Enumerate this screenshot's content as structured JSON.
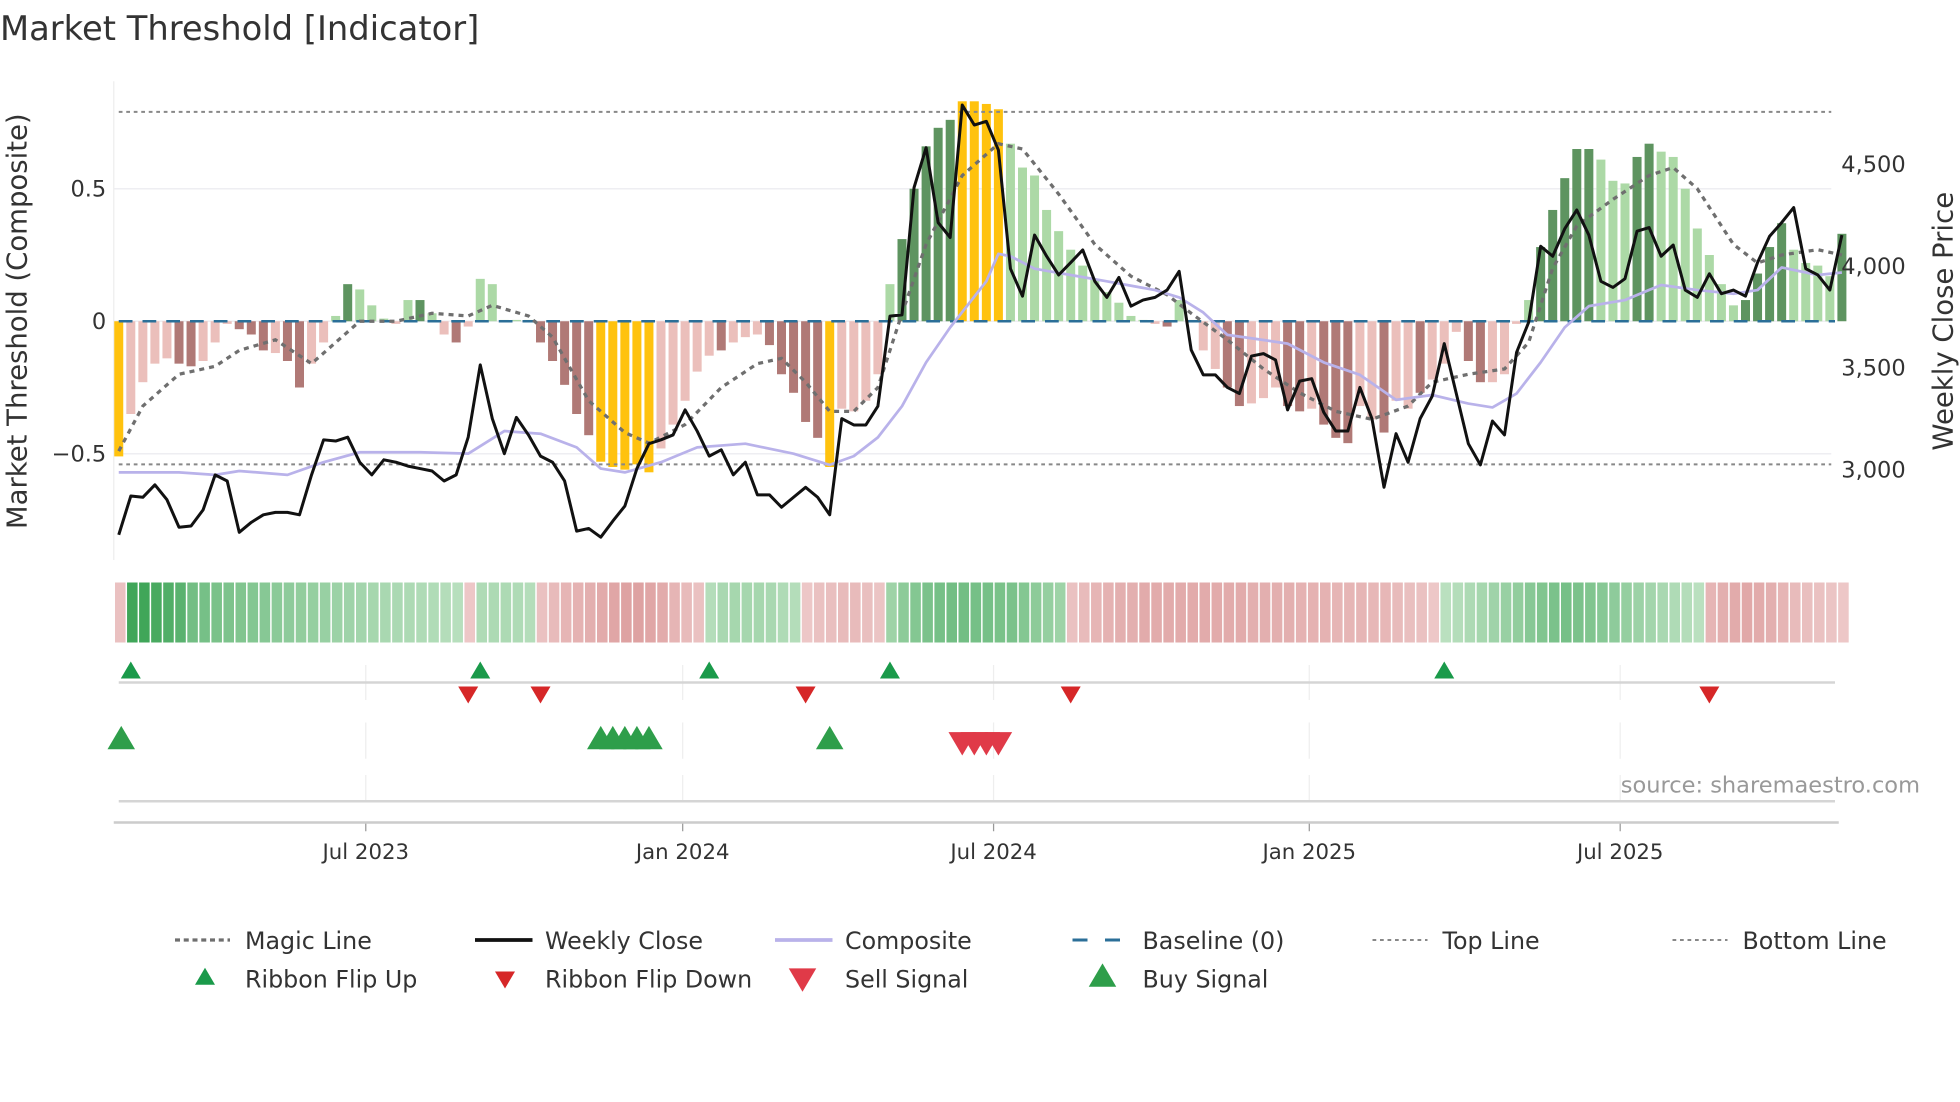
{
  "title": "Market Threshold [Indicator]",
  "source": "source: sharemaestro.com",
  "colors": {
    "yellow": "#ffc20e",
    "dark_green": "#5e9460",
    "light_green": "#acd9a6",
    "dark_red": "#b07976",
    "light_red": "#ebbfbb",
    "black": "#111111",
    "composite": "#b9b2ea",
    "magic": "#6f6f6f",
    "baseline": "#2b6f98",
    "flip_up": "#1a9a4a",
    "flip_down": "#d62728",
    "sell": "#e03a48",
    "buy": "#2e9e4a"
  },
  "chart_data": {
    "type": "bar+line",
    "title": "Market Threshold [Indicator]",
    "xlabel": "",
    "ylabel": "Market Threshold (Composite)",
    "ylabel_right": "Weekly Close Price",
    "ylim": [
      -0.9,
      0.9
    ],
    "ylim_right": [
      2550,
      4900
    ],
    "yticks": [
      {
        "v": 0.5,
        "label": "0.5"
      },
      {
        "v": 0,
        "label": "0"
      },
      {
        "v": -0.5,
        "label": "−0.5"
      }
    ],
    "yticks_right": [
      {
        "v": 4500,
        "label": "4,500"
      },
      {
        "v": 4000,
        "label": "4,000"
      },
      {
        "v": 3500,
        "label": "3,500"
      },
      {
        "v": 3000,
        "label": "3,000"
      }
    ],
    "xticks": [
      {
        "week": 20.5,
        "label": "Jul 2023"
      },
      {
        "week": 46.8,
        "label": "Jan 2024"
      },
      {
        "week": 72.6,
        "label": "Jul 2024"
      },
      {
        "week": 98.8,
        "label": "Jan 2025"
      },
      {
        "week": 124.6,
        "label": "Jul 2025"
      }
    ],
    "top_line": 0.79,
    "bottom_line": -0.54,
    "baseline": 0,
    "composite_bars": [
      -0.51,
      -0.35,
      -0.23,
      -0.16,
      -0.14,
      -0.16,
      -0.17,
      -0.15,
      -0.08,
      -0.01,
      -0.03,
      -0.05,
      -0.11,
      -0.12,
      -0.15,
      -0.25,
      -0.16,
      -0.08,
      0.02,
      0.14,
      0.12,
      0.06,
      0.01,
      -0.01,
      0.08,
      0.08,
      0.03,
      -0.05,
      -0.08,
      -0.02,
      0.16,
      0.14,
      0.005,
      0.005,
      0.005,
      -0.08,
      -0.15,
      -0.24,
      -0.35,
      -0.43,
      -0.53,
      -0.55,
      -0.56,
      -0.54,
      -0.57,
      -0.48,
      -0.39,
      -0.3,
      -0.19,
      -0.13,
      -0.11,
      -0.08,
      -0.06,
      -0.05,
      -0.09,
      -0.2,
      -0.27,
      -0.38,
      -0.44,
      -0.55,
      -0.33,
      -0.34,
      -0.3,
      -0.2,
      0.14,
      0.31,
      0.5,
      0.66,
      0.73,
      0.76,
      0.83,
      0.83,
      0.82,
      0.8,
      0.67,
      0.58,
      0.55,
      0.42,
      0.34,
      0.27,
      0.21,
      0.16,
      0.11,
      0.07,
      0.02,
      0.005,
      -0.01,
      -0.02,
      0.08,
      0.005,
      -0.11,
      -0.18,
      -0.25,
      -0.32,
      -0.31,
      -0.29,
      -0.25,
      -0.32,
      -0.34,
      -0.33,
      -0.39,
      -0.44,
      -0.46,
      -0.32,
      -0.37,
      -0.42,
      -0.3,
      -0.33,
      -0.27,
      -0.22,
      -0.16,
      -0.04,
      -0.15,
      -0.23,
      -0.23,
      -0.2,
      -0.01,
      0.08,
      0.28,
      0.42,
      0.54,
      0.65,
      0.65,
      0.61,
      0.53,
      0.52,
      0.62,
      0.67,
      0.64,
      0.62,
      0.5,
      0.35,
      0.25,
      0.14,
      0.06,
      0.08,
      0.18,
      0.28,
      0.37,
      0.27,
      0.22,
      0.21,
      0.17,
      0.33
    ],
    "bar_classes": "YrrrrRRrrrRRRrRRrrgGgggrgGgrRrgggggRRRRRYYYYYrrrrrRrrrRRRRRYrrrrgGGGGGYYYYggggggggggggrRggrrRRrrrRRrRRRrrRrrRrrrRRrrrgGGGGGgggGGgggggggGGGGggggG",
    "weekly_close": [
      2676,
      2866,
      2860,
      2921,
      2848,
      2713,
      2719,
      2798,
      2970,
      2940,
      2688,
      2737,
      2774,
      2786,
      2786,
      2774,
      2970,
      3142,
      3136,
      3155,
      3032,
      2970,
      3044,
      3032,
      3013,
      3001,
      2989,
      2940,
      2970,
      3155,
      3510,
      3246,
      3074,
      3252,
      3166,
      3062,
      3032,
      2940,
      2694,
      2707,
      2664,
      2743,
      2817,
      3001,
      3123,
      3142,
      3166,
      3289,
      3185,
      3062,
      3093,
      2970,
      3032,
      2872,
      2872,
      2811,
      2860,
      2909,
      2860,
      2774,
      3246,
      3215,
      3215,
      3307,
      3749,
      3755,
      4380,
      4576,
      4208,
      4135,
      4785,
      4687,
      4705,
      4564,
      3982,
      3847,
      4147,
      4043,
      3951,
      4012,
      4074,
      3920,
      3841,
      3939,
      3798,
      3828,
      3841,
      3877,
      3969,
      3583,
      3461,
      3461,
      3399,
      3369,
      3553,
      3565,
      3534,
      3289,
      3430,
      3442,
      3277,
      3185,
      3185,
      3399,
      3246,
      2909,
      3172,
      3032,
      3246,
      3356,
      3614,
      3369,
      3123,
      3019,
      3234,
      3166,
      3571,
      3718,
      4092,
      4043,
      4178,
      4270,
      4147,
      3920,
      3890,
      3933,
      4166,
      4184,
      4043,
      4098,
      3877,
      3841,
      3957,
      3859,
      3877,
      3847,
      4012,
      4141,
      4208,
      4282,
      3982,
      3951,
      3877,
      4147
    ],
    "magic_line": [
      [
        0,
        -0.49
      ],
      [
        2,
        -0.32
      ],
      [
        5,
        -0.2
      ],
      [
        8,
        -0.17
      ],
      [
        10,
        -0.11
      ],
      [
        13,
        -0.07
      ],
      [
        16,
        -0.16
      ],
      [
        18,
        -0.08
      ],
      [
        20,
        0
      ],
      [
        23,
        0
      ],
      [
        26,
        0.03
      ],
      [
        29,
        0.02
      ],
      [
        31,
        0.06
      ],
      [
        34,
        0.02
      ],
      [
        36,
        -0.06
      ],
      [
        39,
        -0.3
      ],
      [
        42,
        -0.42
      ],
      [
        44,
        -0.46
      ],
      [
        47,
        -0.39
      ],
      [
        50,
        -0.25
      ],
      [
        53,
        -0.16
      ],
      [
        55,
        -0.14
      ],
      [
        57,
        -0.23
      ],
      [
        59,
        -0.34
      ],
      [
        61,
        -0.34
      ],
      [
        63,
        -0.25
      ],
      [
        65,
        0.03
      ],
      [
        67,
        0.29
      ],
      [
        70,
        0.55
      ],
      [
        73,
        0.67
      ],
      [
        75,
        0.65
      ],
      [
        78,
        0.48
      ],
      [
        81,
        0.29
      ],
      [
        84,
        0.17
      ],
      [
        87,
        0.1
      ],
      [
        89,
        0.03
      ],
      [
        92,
        -0.07
      ],
      [
        95,
        -0.18
      ],
      [
        98,
        -0.27
      ],
      [
        101,
        -0.34
      ],
      [
        104,
        -0.37
      ],
      [
        107,
        -0.32
      ],
      [
        109,
        -0.23
      ],
      [
        112,
        -0.2
      ],
      [
        115,
        -0.18
      ],
      [
        117,
        -0.08
      ],
      [
        119,
        0.2
      ],
      [
        121,
        0.36
      ],
      [
        124,
        0.46
      ],
      [
        127,
        0.55
      ],
      [
        129,
        0.58
      ],
      [
        131,
        0.5
      ],
      [
        134,
        0.29
      ],
      [
        136,
        0.22
      ],
      [
        138,
        0.25
      ],
      [
        141,
        0.27
      ],
      [
        143,
        0.25
      ]
    ],
    "composite_line": [
      [
        0,
        2982
      ],
      [
        5,
        2982
      ],
      [
        8,
        2970
      ],
      [
        10,
        2989
      ],
      [
        14,
        2970
      ],
      [
        17,
        3032
      ],
      [
        20,
        3081
      ],
      [
        25,
        3081
      ],
      [
        29,
        3074
      ],
      [
        32,
        3185
      ],
      [
        35,
        3172
      ],
      [
        38,
        3105
      ],
      [
        40,
        3001
      ],
      [
        42,
        2982
      ],
      [
        45,
        3032
      ],
      [
        48,
        3105
      ],
      [
        52,
        3123
      ],
      [
        56,
        3074
      ],
      [
        59,
        3019
      ],
      [
        61,
        3062
      ],
      [
        63,
        3154
      ],
      [
        65,
        3307
      ],
      [
        67,
        3522
      ],
      [
        69,
        3694
      ],
      [
        72,
        3920
      ],
      [
        73,
        4055
      ],
      [
        74,
        4043
      ],
      [
        76,
        3982
      ],
      [
        79,
        3951
      ],
      [
        82,
        3920
      ],
      [
        86,
        3877
      ],
      [
        88,
        3841
      ],
      [
        90,
        3767
      ],
      [
        92,
        3657
      ],
      [
        95,
        3632
      ],
      [
        97,
        3614
      ],
      [
        100,
        3522
      ],
      [
        103,
        3461
      ],
      [
        106,
        3338
      ],
      [
        109,
        3362
      ],
      [
        112,
        3320
      ],
      [
        114,
        3301
      ],
      [
        116,
        3369
      ],
      [
        118,
        3522
      ],
      [
        120,
        3694
      ],
      [
        122,
        3798
      ],
      [
        125,
        3828
      ],
      [
        128,
        3902
      ],
      [
        131,
        3877
      ],
      [
        134,
        3859
      ],
      [
        136,
        3877
      ],
      [
        138,
        3988
      ],
      [
        141,
        3951
      ],
      [
        143,
        3963
      ]
    ],
    "ribbon": [
      -0.2,
      0.9,
      0.9,
      0.85,
      0.8,
      0.75,
      0.6,
      0.58,
      0.56,
      0.54,
      0.52,
      0.5,
      0.48,
      0.46,
      0.44,
      0.42,
      0.4,
      0.38,
      0.36,
      0.34,
      0.32,
      0.3,
      0.28,
      0.27,
      0.26,
      0.25,
      0.24,
      0.22,
      0.2,
      -0.15,
      0.25,
      0.26,
      0.26,
      0.25,
      0.22,
      -0.2,
      -0.25,
      -0.3,
      -0.32,
      -0.35,
      -0.38,
      -0.42,
      -0.45,
      -0.45,
      -0.42,
      -0.38,
      -0.3,
      -0.25,
      -0.2,
      0.22,
      0.28,
      0.3,
      0.3,
      0.3,
      0.28,
      0.25,
      0.22,
      -0.15,
      -0.2,
      -0.22,
      -0.25,
      -0.25,
      -0.22,
      -0.18,
      0.35,
      0.45,
      0.5,
      0.55,
      0.58,
      0.6,
      0.6,
      0.58,
      0.58,
      0.56,
      0.55,
      0.5,
      0.45,
      0.4,
      0.35,
      -0.2,
      -0.25,
      -0.3,
      -0.32,
      -0.35,
      -0.35,
      -0.38,
      -0.38,
      -0.38,
      -0.38,
      -0.38,
      -0.38,
      -0.38,
      -0.38,
      -0.38,
      -0.35,
      -0.35,
      -0.35,
      -0.35,
      -0.32,
      -0.32,
      -0.32,
      -0.3,
      -0.3,
      -0.3,
      -0.28,
      -0.28,
      -0.25,
      -0.22,
      -0.2,
      -0.15,
      0.18,
      0.22,
      0.26,
      0.3,
      0.34,
      0.38,
      0.42,
      0.48,
      0.52,
      0.55,
      0.58,
      0.55,
      0.52,
      0.48,
      0.44,
      0.4,
      0.36,
      0.32,
      0.28,
      0.25,
      0.22,
      0.18,
      -0.3,
      -0.35,
      -0.38,
      -0.4,
      -0.38,
      -0.35,
      -0.3,
      -0.25,
      -0.22,
      -0.2,
      -0.18,
      -0.15
    ],
    "ribbon_flip_up": [
      1,
      30,
      49,
      64,
      110
    ],
    "ribbon_flip_down": [
      29,
      35,
      57,
      79,
      132
    ],
    "buy_signal": [
      0,
      40,
      41,
      42,
      43,
      44,
      59
    ],
    "sell_signal": [
      70,
      71,
      72,
      73
    ],
    "legend": {
      "placement": "bottom",
      "items": [
        {
          "key": "magic",
          "label": "Magic Line"
        },
        {
          "key": "close",
          "label": "Weekly Close"
        },
        {
          "key": "composite",
          "label": "Composite"
        },
        {
          "key": "baseline",
          "label": "Baseline (0)"
        },
        {
          "key": "top",
          "label": "Top Line"
        },
        {
          "key": "bottom",
          "label": "Bottom Line"
        },
        {
          "key": "flip_up",
          "label": "Ribbon Flip Up"
        },
        {
          "key": "flip_down",
          "label": "Ribbon Flip Down"
        },
        {
          "key": "sell",
          "label": "Sell Signal"
        },
        {
          "key": "buy",
          "label": "Buy Signal"
        }
      ]
    }
  }
}
